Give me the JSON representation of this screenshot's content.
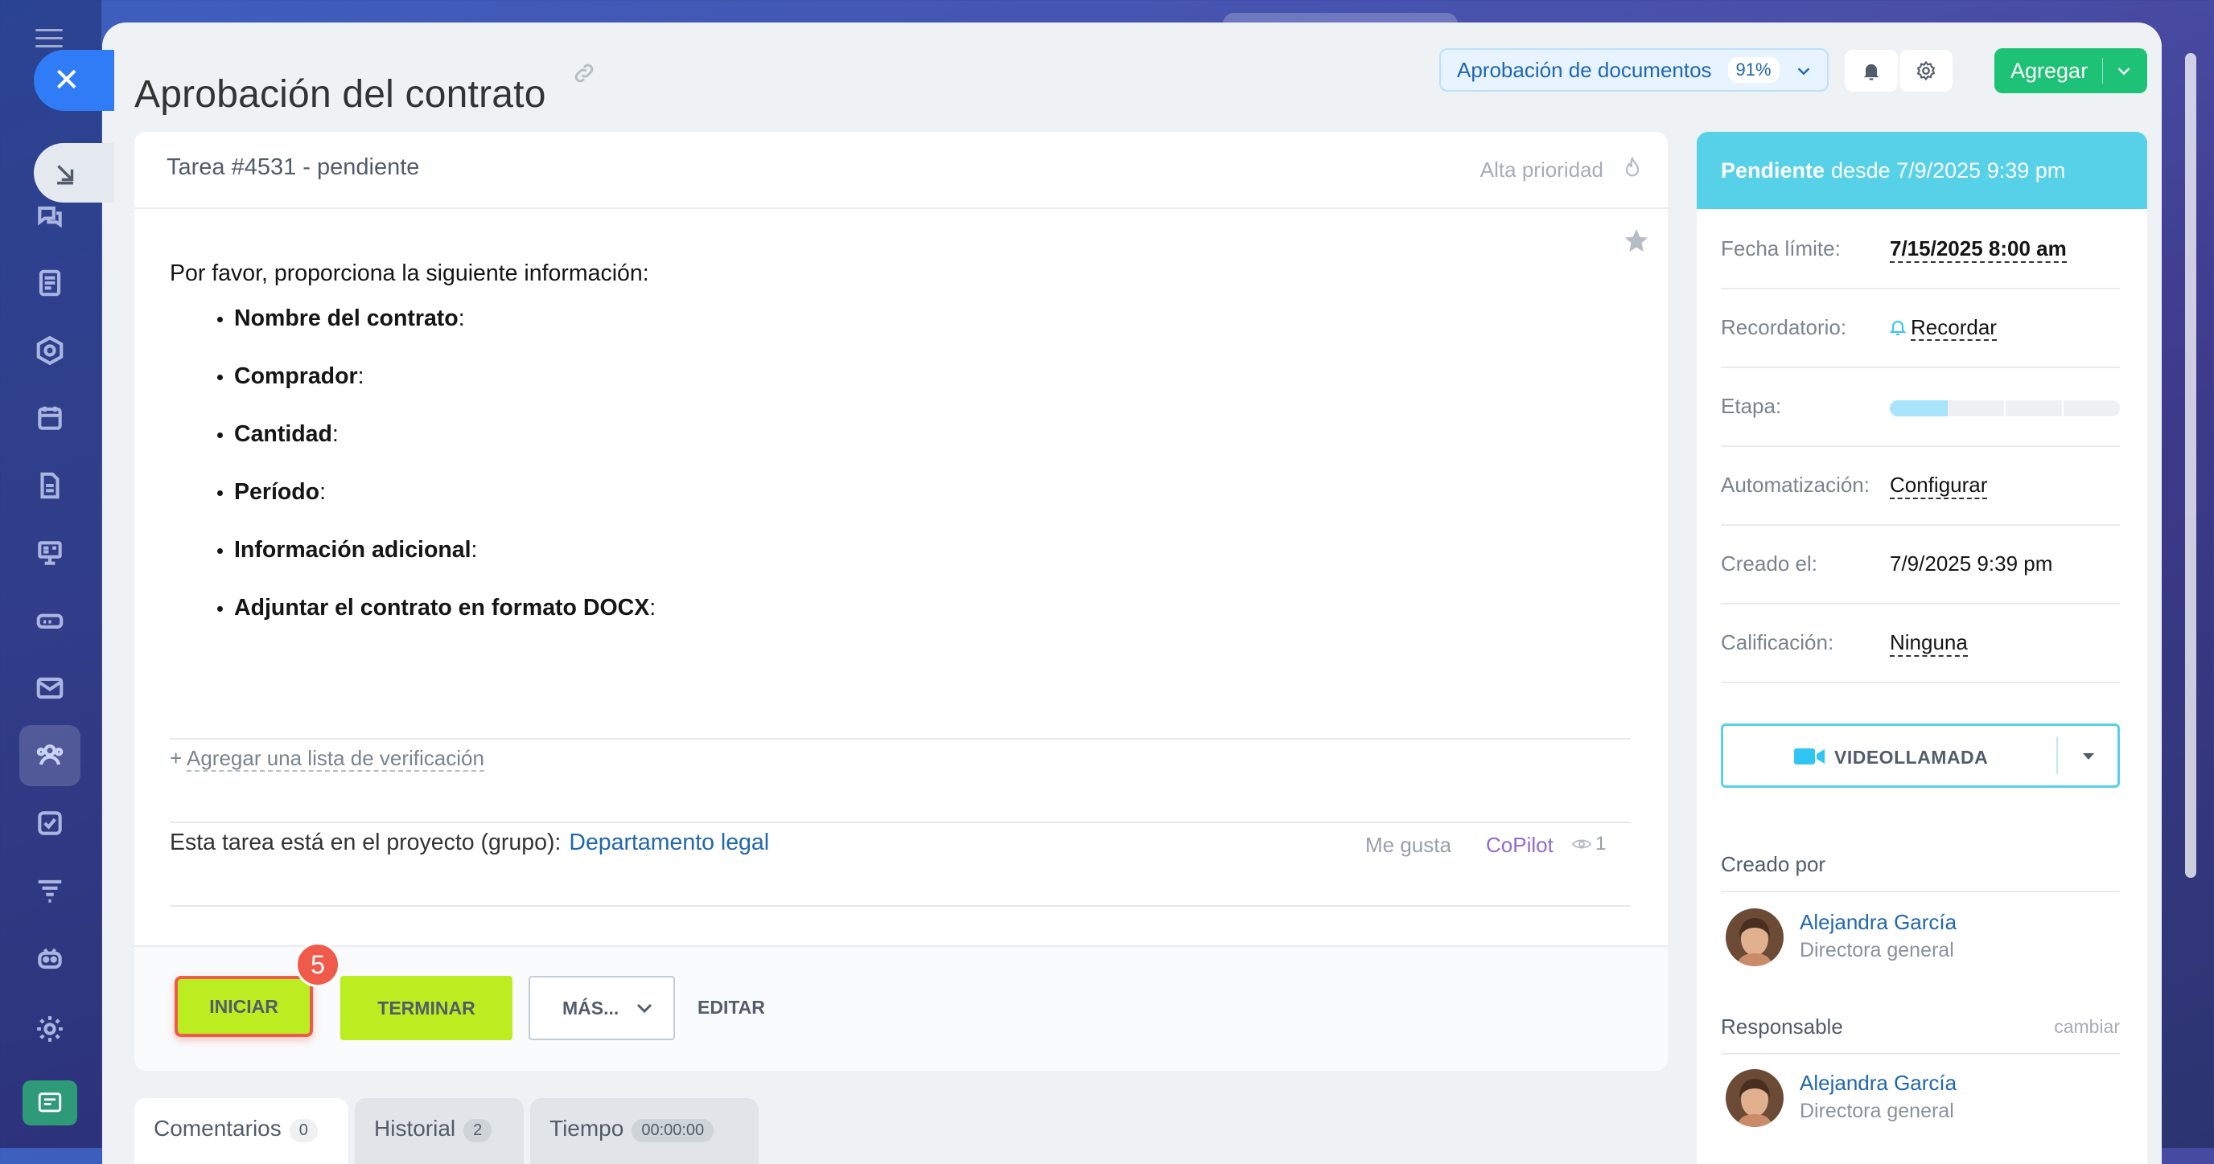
{
  "header": {
    "title": "Aprobación del contrato",
    "workflow_label": "Aprobación de documentos",
    "workflow_percent": "91%",
    "add_label": "Agregar"
  },
  "task": {
    "title": "Tarea #4531 - pendiente",
    "priority": "Alta prioridad",
    "intro": "Por favor, proporciona la siguiente información:",
    "fields": [
      "Nombre del contrato",
      "Comprador",
      "Cantidad",
      "Período",
      "Información adicional",
      "Adjuntar el contrato en formato DOCX"
    ],
    "checklist_prefix": "+ ",
    "checklist_label": "Agregar una lista de verificación",
    "project_text": "Esta tarea está en el proyecto (grupo):",
    "project_link": "Departamento legal",
    "likes": "Me gusta",
    "copilot": "CoPilot",
    "views": "1"
  },
  "actions": {
    "start": "INICIAR",
    "step_badge": "5",
    "finish": "TERMINAR",
    "more": "MÁS...",
    "edit": "EDITAR"
  },
  "tabs": [
    {
      "label": "Comentarios",
      "count": "0"
    },
    {
      "label": "Historial",
      "count": "2"
    },
    {
      "label": "Tiempo",
      "count": "00:00:00"
    }
  ],
  "sidebar": {
    "status_bold": "Pendiente",
    "status_rest": "desde 7/9/2025 9:39 pm",
    "rows": {
      "deadline": {
        "label": "Fecha límite:",
        "value": "7/15/2025 8:00 am"
      },
      "reminder": {
        "label": "Recordatorio:",
        "value": "Recordar"
      },
      "stage": {
        "label": "Etapa:",
        "progress": 0.25
      },
      "automation": {
        "label": "Automatización:",
        "value": "Configurar"
      },
      "created": {
        "label": "Creado el:",
        "value": "7/9/2025 9:39 pm"
      },
      "rating": {
        "label": "Calificación:",
        "value": "Ninguna"
      }
    },
    "video_label": "VIDEOLLAMADA",
    "created_by_title": "Creado por",
    "creator": {
      "name": "Alejandra García",
      "role": "Directora general"
    },
    "responsible_title": "Responsable",
    "change_label": "cambiar",
    "responsible": {
      "name": "Alejandra García",
      "role": "Directora general"
    }
  },
  "colors": {
    "accent_green": "#bbed21",
    "status_cyan": "#56d1e8",
    "add_green": "#1ec276",
    "link_blue": "#2067b0",
    "highlight_red": "#f05a4a"
  }
}
